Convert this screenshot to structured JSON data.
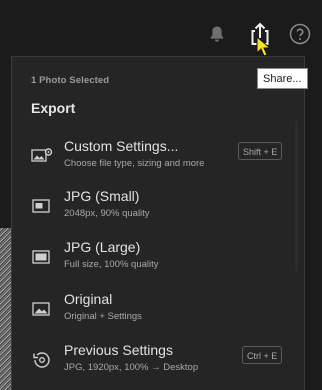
{
  "topbar": {
    "icons": [
      "bell-icon",
      "share-icon",
      "help-icon"
    ],
    "tooltip": "Share..."
  },
  "export_panel": {
    "selected_count": "1 Photo Selected",
    "section_title": "Export",
    "items": [
      {
        "icon": "custom-settings-icon",
        "label": "Custom Settings...",
        "description": "Choose file type, sizing and more",
        "shortcut": "Shift + E"
      },
      {
        "icon": "jpg-small-icon",
        "label": "JPG (Small)",
        "description": "2048px, 90% quality"
      },
      {
        "icon": "jpg-large-icon",
        "label": "JPG (Large)",
        "description": "Full size, 100% quality"
      },
      {
        "icon": "original-icon",
        "label": "Original",
        "description": "Original + Settings"
      },
      {
        "icon": "previous-settings-icon",
        "label": "Previous Settings",
        "description": "JPG, 1920px, 100% → Desktop",
        "shortcut": "Ctrl + E"
      }
    ]
  },
  "colors": {
    "background": "#1b1b1b",
    "panel": "#252525",
    "text_primary": "#e2e2e2",
    "text_secondary": "#a8a8a8",
    "cursor": "#f5e12a"
  }
}
